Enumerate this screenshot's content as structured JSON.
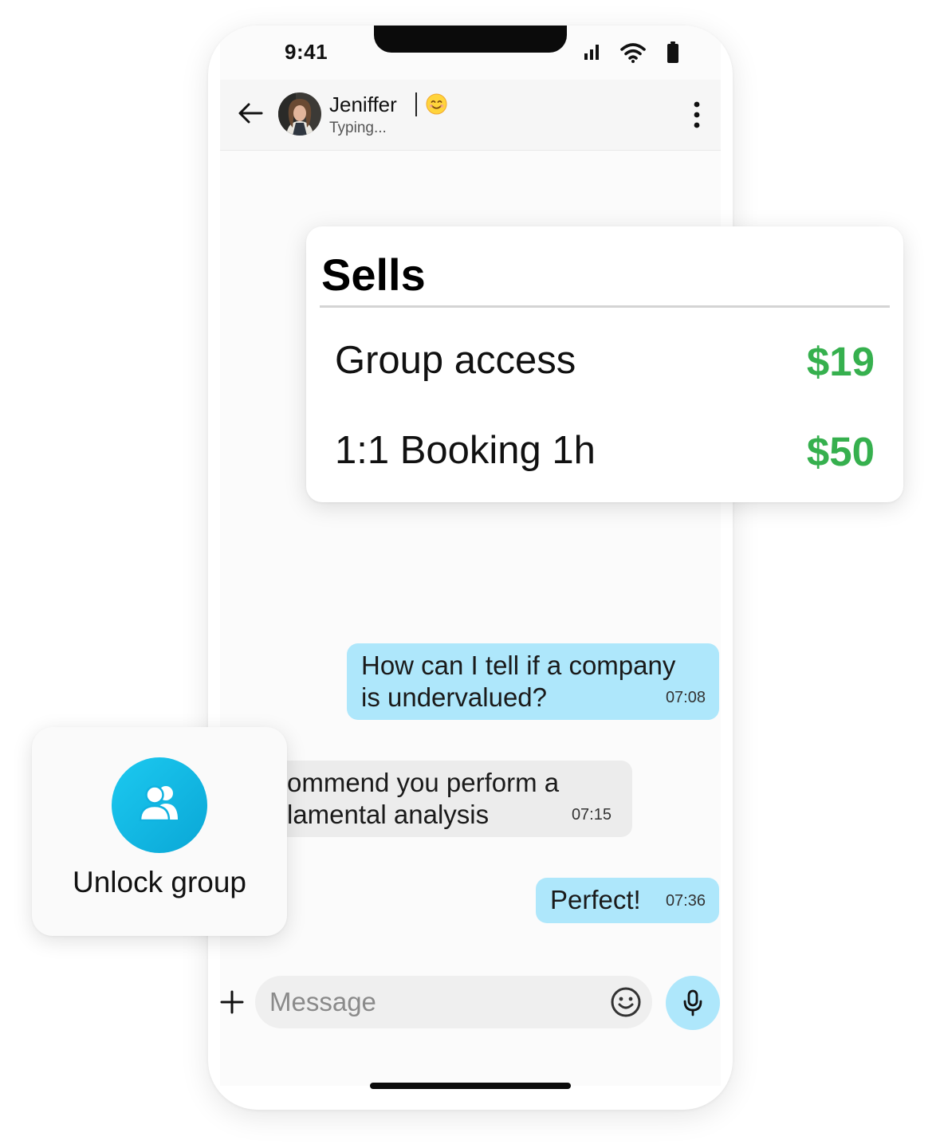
{
  "status_bar": {
    "time": "9:41"
  },
  "chat_header": {
    "contact_name": "Jeniffer",
    "contact_status": "Typing..."
  },
  "messages": [
    {
      "direction": "outgoing",
      "text": "How can I tell if a company\nis undervalued?",
      "time": "07:08"
    },
    {
      "direction": "incoming",
      "text": "ommend you perform a\nlamental analysis",
      "time": "07:15"
    },
    {
      "direction": "outgoing",
      "text": "Perfect!",
      "time": "07:36"
    }
  ],
  "input_bar": {
    "placeholder": "Message"
  },
  "sells_card": {
    "title": "Sells",
    "items": [
      {
        "label": "Group access",
        "price": "$19"
      },
      {
        "label": "1:1 Booking 1h",
        "price": "$50"
      }
    ]
  },
  "unlock_card": {
    "label": "Unlock group"
  },
  "colors": {
    "outgoing_bubble": "#aee7fb",
    "incoming_bubble": "#ececec",
    "price_green": "#36b04e",
    "unlock_accent": "#12b8e4"
  },
  "icons": [
    "back-arrow-icon",
    "menu-dots-icon",
    "plus-icon",
    "smiley-icon",
    "microphone-icon",
    "group-icon",
    "signal-icon",
    "wifi-icon",
    "battery-icon"
  ]
}
